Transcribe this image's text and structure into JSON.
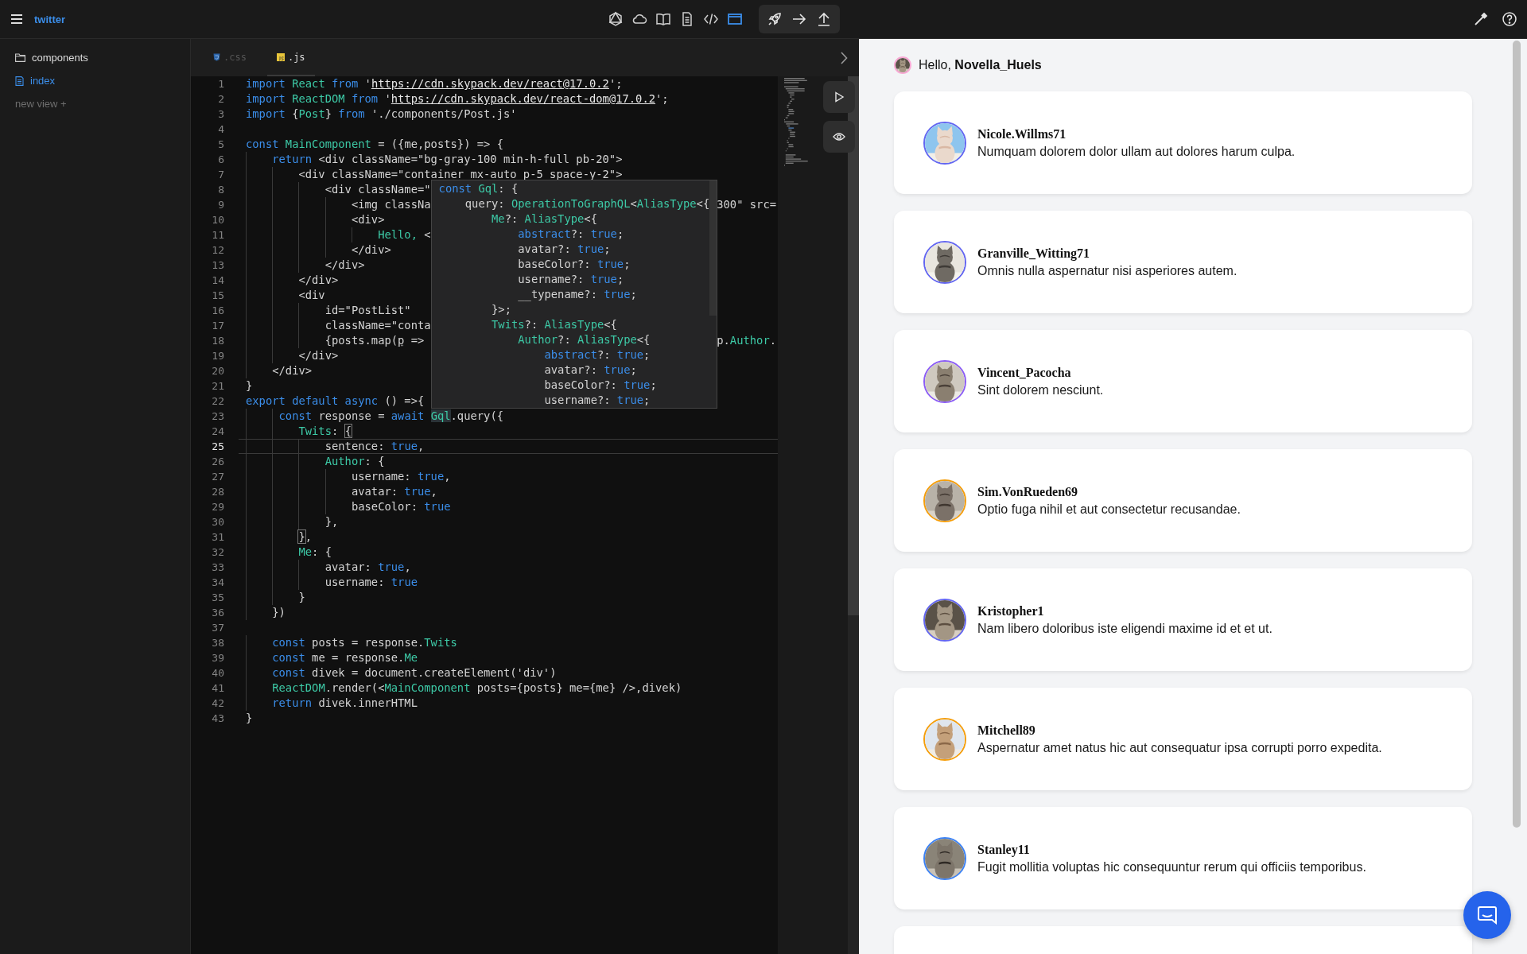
{
  "app": {
    "title": "twitter"
  },
  "toolbar": {
    "tools": [
      {
        "kind": "graph",
        "selected": false
      },
      {
        "kind": "cloud",
        "selected": false
      },
      {
        "kind": "book",
        "selected": false
      },
      {
        "kind": "document",
        "selected": false
      },
      {
        "kind": "code",
        "selected": false
      },
      {
        "kind": "window",
        "selected": true
      }
    ],
    "actions": [
      {
        "kind": "rocket"
      },
      {
        "kind": "arrow"
      },
      {
        "kind": "upload"
      }
    ]
  },
  "sidebar": {
    "items": [
      {
        "label": "components",
        "kind": "folder",
        "selected": false
      },
      {
        "label": "index",
        "kind": "file",
        "selected": true
      }
    ],
    "new_view": "new view +"
  },
  "tabs": [
    {
      "label": ".css",
      "kind": "css",
      "selected": false
    },
    {
      "label": ".js",
      "kind": "js",
      "selected": true
    }
  ],
  "editor": {
    "lines": [
      {
        "number": "1",
        "current": false,
        "segments": [
          {
            "kind": "kw",
            "text": "import"
          },
          {
            "kind": "type",
            "text": " React"
          },
          {
            "kind": "kw",
            "text": " from"
          },
          {
            "kind": "plain",
            "text": " '"
          },
          {
            "kind": "url",
            "text": "https://cdn.skypack.dev/react@17.0.2"
          },
          {
            "kind": "plain",
            "text": "';"
          }
        ]
      },
      {
        "number": "2",
        "current": false,
        "segments": [
          {
            "kind": "kw",
            "text": "import"
          },
          {
            "kind": "type",
            "text": " ReactDOM"
          },
          {
            "kind": "kw",
            "text": " from"
          },
          {
            "kind": "plain",
            "text": " '"
          },
          {
            "kind": "url",
            "text": "https://cdn.skypack.dev/react-dom@17.0.2"
          },
          {
            "kind": "plain",
            "text": "';"
          }
        ]
      },
      {
        "number": "3",
        "current": false,
        "segments": [
          {
            "kind": "kw",
            "text": "import"
          },
          {
            "kind": "plain",
            "text": " {"
          },
          {
            "kind": "type",
            "text": "Post"
          },
          {
            "kind": "plain",
            "text": "} "
          },
          {
            "kind": "kw",
            "text": "from"
          },
          {
            "kind": "plain",
            "text": " './components/Post.js'"
          }
        ]
      },
      {
        "number": "4",
        "current": false
      },
      {
        "number": "5",
        "current": false,
        "segments": [
          {
            "kind": "kw",
            "text": "const"
          },
          {
            "kind": "type",
            "text": " MainComponent"
          },
          {
            "kind": "plain",
            "text": " = ({me,posts}) => {"
          }
        ]
      },
      {
        "number": "6",
        "current": false,
        "segments": [
          {
            "kind": "kw",
            "text": "    return"
          },
          {
            "kind": "plain",
            "text": " <div className=\"bg-gray-100 min-h-full pb-20\">"
          }
        ]
      },
      {
        "number": "7",
        "current": false,
        "segments": [
          {
            "kind": "plain",
            "text": "        <div className=\"container mx-auto p-5 space-y-2\">"
          }
        ]
      },
      {
        "number": "8",
        "current": false,
        "segments": [
          {
            "kind": "plain",
            "text": "            <div className=\""
          }
        ]
      },
      {
        "number": "9",
        "current": false,
        "segments": [
          {
            "kind": "plain",
            "text": "                <img classNa"
          }
        ],
        "after": [
          {
            "kind": "plain",
            "text": "300\" src="
          }
        ]
      },
      {
        "number": "10",
        "current": false,
        "segments": [
          {
            "kind": "plain",
            "text": "                <div>"
          }
        ]
      },
      {
        "number": "11",
        "current": false,
        "segments": [
          {
            "kind": "type",
            "text": "                    Hello,"
          },
          {
            "kind": "plain",
            "text": " <"
          }
        ]
      },
      {
        "number": "12",
        "current": false,
        "segments": [
          {
            "kind": "plain",
            "text": "                </div>"
          }
        ]
      },
      {
        "number": "13",
        "current": false,
        "segments": [
          {
            "kind": "plain",
            "text": "            </div>"
          }
        ]
      },
      {
        "number": "14",
        "current": false,
        "segments": [
          {
            "kind": "plain",
            "text": "        </div>"
          }
        ]
      },
      {
        "number": "15",
        "current": false,
        "segments": [
          {
            "kind": "plain",
            "text": "        <div"
          }
        ]
      },
      {
        "number": "16",
        "current": false,
        "segments": [
          {
            "kind": "plain",
            "text": "            id=\"PostList\""
          }
        ]
      },
      {
        "number": "17",
        "current": false,
        "segments": [
          {
            "kind": "plain",
            "text": "            className=\"conta"
          }
        ]
      },
      {
        "number": "18",
        "current": false,
        "segments": [
          {
            "kind": "plain",
            "text": "            {posts.map("
          },
          {
            "kind": "squiggle",
            "text": "p"
          },
          {
            "kind": "plain",
            "text": " =>"
          }
        ],
        "after": [
          {
            "kind": "plain",
            "text": "p."
          },
          {
            "kind": "type",
            "text": "Author"
          },
          {
            "kind": "plain",
            "text": "."
          }
        ]
      },
      {
        "number": "19",
        "current": false,
        "segments": [
          {
            "kind": "plain",
            "text": "        </div>"
          }
        ]
      },
      {
        "number": "20",
        "current": false,
        "segments": [
          {
            "kind": "plain",
            "text": "    </div>"
          }
        ]
      },
      {
        "number": "21",
        "current": false,
        "segments": [
          {
            "kind": "plain",
            "text": "}"
          }
        ]
      },
      {
        "number": "22",
        "current": false,
        "segments": [
          {
            "kind": "kw",
            "text": "export default async"
          },
          {
            "kind": "plain",
            "text": " () =>{"
          }
        ]
      },
      {
        "number": "23",
        "current": false,
        "segments": [
          {
            "kind": "kw",
            "text": "     const"
          },
          {
            "kind": "plain",
            "text": " response = "
          },
          {
            "kind": "kw",
            "text": "await"
          },
          {
            "kind": "highlight",
            "text": " Gql"
          },
          {
            "kind": "plain",
            "text": ".query({"
          }
        ]
      },
      {
        "number": "24",
        "current": false,
        "segments": [
          {
            "kind": "type",
            "text": "        Twits"
          },
          {
            "kind": "plain",
            "text": ": "
          },
          {
            "kind": "bracket",
            "text": "{"
          }
        ]
      },
      {
        "number": "25",
        "current": true,
        "segments": [
          {
            "kind": "plain",
            "text": "            sentence: "
          },
          {
            "kind": "kw",
            "text": "true"
          },
          {
            "kind": "plain",
            "text": ","
          }
        ]
      },
      {
        "number": "26",
        "current": false,
        "segments": [
          {
            "kind": "type",
            "text": "            Author"
          },
          {
            "kind": "plain",
            "text": ": {"
          }
        ]
      },
      {
        "number": "27",
        "current": false,
        "segments": [
          {
            "kind": "plain",
            "text": "                username: "
          },
          {
            "kind": "kw",
            "text": "true"
          },
          {
            "kind": "plain",
            "text": ","
          }
        ]
      },
      {
        "number": "28",
        "current": false,
        "segments": [
          {
            "kind": "plain",
            "text": "                avatar: "
          },
          {
            "kind": "kw",
            "text": "true"
          },
          {
            "kind": "plain",
            "text": ","
          }
        ]
      },
      {
        "number": "29",
        "current": false,
        "segments": [
          {
            "kind": "plain",
            "text": "                baseColor: "
          },
          {
            "kind": "kw",
            "text": "true"
          }
        ]
      },
      {
        "number": "30",
        "current": false,
        "segments": [
          {
            "kind": "plain",
            "text": "            },"
          }
        ]
      },
      {
        "number": "31",
        "current": false,
        "segments": [
          {
            "kind": "bracket",
            "text": "        }"
          },
          {
            "kind": "plain",
            "text": ","
          }
        ]
      },
      {
        "number": "32",
        "current": false,
        "segments": [
          {
            "kind": "type",
            "text": "        Me"
          },
          {
            "kind": "plain",
            "text": ": {"
          }
        ]
      },
      {
        "number": "33",
        "current": false,
        "segments": [
          {
            "kind": "plain",
            "text": "            avatar: "
          },
          {
            "kind": "kw",
            "text": "true"
          },
          {
            "kind": "plain",
            "text": ","
          }
        ]
      },
      {
        "number": "34",
        "current": false,
        "segments": [
          {
            "kind": "plain",
            "text": "            username: "
          },
          {
            "kind": "kw",
            "text": "true"
          }
        ]
      },
      {
        "number": "35",
        "current": false,
        "segments": [
          {
            "kind": "plain",
            "text": "        }"
          }
        ]
      },
      {
        "number": "36",
        "current": false,
        "segments": [
          {
            "kind": "plain",
            "text": "    })"
          }
        ]
      },
      {
        "number": "37",
        "current": false
      },
      {
        "number": "38",
        "current": false,
        "segments": [
          {
            "kind": "kw",
            "text": "    const"
          },
          {
            "kind": "plain",
            "text": " posts = response."
          },
          {
            "kind": "type",
            "text": "Twits"
          }
        ]
      },
      {
        "number": "39",
        "current": false,
        "segments": [
          {
            "kind": "kw",
            "text": "    const"
          },
          {
            "kind": "plain",
            "text": " me = response."
          },
          {
            "kind": "type",
            "text": "Me"
          }
        ]
      },
      {
        "number": "40",
        "current": false,
        "segments": [
          {
            "kind": "kw",
            "text": "    const"
          },
          {
            "kind": "plain",
            "text": " divek = document.createElement('div')"
          }
        ]
      },
      {
        "number": "41",
        "current": false,
        "segments": [
          {
            "kind": "type",
            "text": "    ReactDOM"
          },
          {
            "kind": "plain",
            "text": ".render(<"
          },
          {
            "kind": "type",
            "text": "MainComponent"
          },
          {
            "kind": "plain",
            "text": " posts={posts} me={me} />,divek)"
          }
        ]
      },
      {
        "number": "42",
        "current": false,
        "segments": [
          {
            "kind": "kw",
            "text": "    return"
          },
          {
            "kind": "plain",
            "text": " divek.innerHTML"
          }
        ]
      },
      {
        "number": "43",
        "current": false,
        "segments": [
          {
            "kind": "plain",
            "text": "}"
          }
        ]
      }
    ],
    "tooltip": [
      [
        {
          "kind": "kw",
          "text": "const"
        },
        {
          "kind": "type",
          "text": " Gql"
        },
        {
          "kind": "plain",
          "text": ": {"
        }
      ],
      [
        {
          "kind": "plain",
          "text": "    query: "
        },
        {
          "kind": "type",
          "text": "OperationToGraphQL"
        },
        {
          "kind": "plain",
          "text": "<"
        },
        {
          "kind": "type",
          "text": "AliasType"
        },
        {
          "kind": "plain",
          "text": "<{"
        }
      ],
      [
        {
          "kind": "type",
          "text": "        Me"
        },
        {
          "kind": "plain",
          "text": "?: "
        },
        {
          "kind": "type",
          "text": "AliasType"
        },
        {
          "kind": "plain",
          "text": "<{"
        }
      ],
      [
        {
          "kind": "kw",
          "text": "            abstract"
        },
        {
          "kind": "plain",
          "text": "?: "
        },
        {
          "kind": "kw",
          "text": "true"
        },
        {
          "kind": "plain",
          "text": ";"
        }
      ],
      [
        {
          "kind": "plain",
          "text": "            avatar?: "
        },
        {
          "kind": "kw",
          "text": "true"
        },
        {
          "kind": "plain",
          "text": ";"
        }
      ],
      [
        {
          "kind": "plain",
          "text": "            baseColor?: "
        },
        {
          "kind": "kw",
          "text": "true"
        },
        {
          "kind": "plain",
          "text": ";"
        }
      ],
      [
        {
          "kind": "plain",
          "text": "            username?: "
        },
        {
          "kind": "kw",
          "text": "true"
        },
        {
          "kind": "plain",
          "text": ";"
        }
      ],
      [
        {
          "kind": "plain",
          "text": "            __typename?: "
        },
        {
          "kind": "kw",
          "text": "true"
        },
        {
          "kind": "plain",
          "text": ";"
        }
      ],
      [
        {
          "kind": "plain",
          "text": "        }>;"
        }
      ],
      [
        {
          "kind": "type",
          "text": "        Twits"
        },
        {
          "kind": "plain",
          "text": "?: "
        },
        {
          "kind": "type",
          "text": "AliasType"
        },
        {
          "kind": "plain",
          "text": "<{"
        }
      ],
      [
        {
          "kind": "type",
          "text": "            Author"
        },
        {
          "kind": "plain",
          "text": "?: "
        },
        {
          "kind": "type",
          "text": "AliasType"
        },
        {
          "kind": "plain",
          "text": "<{"
        }
      ],
      [
        {
          "kind": "kw",
          "text": "                abstract"
        },
        {
          "kind": "plain",
          "text": "?: "
        },
        {
          "kind": "kw",
          "text": "true"
        },
        {
          "kind": "plain",
          "text": ";"
        }
      ],
      [
        {
          "kind": "plain",
          "text": "                avatar?: "
        },
        {
          "kind": "kw",
          "text": "true"
        },
        {
          "kind": "plain",
          "text": ";"
        }
      ],
      [
        {
          "kind": "plain",
          "text": "                baseColor?: "
        },
        {
          "kind": "kw",
          "text": "true"
        },
        {
          "kind": "plain",
          "text": ";"
        }
      ],
      [
        {
          "kind": "plain",
          "text": "                username?: "
        },
        {
          "kind": "kw",
          "text": "true"
        },
        {
          "kind": "plain",
          "text": ";"
        }
      ]
    ]
  },
  "preview": {
    "greeting": "Hello, **Novella_Huels**",
    "posts": [
      {
        "username": "Nicole.Willms71",
        "sentence": "Numquam dolorem dolor ullam aut dolores harum culpa.",
        "color": "#6366f1"
      },
      {
        "username": "Granville_Witting71",
        "sentence": "Omnis nulla aspernatur nisi asperiores autem.",
        "color": "#6366f1"
      },
      {
        "username": "Vincent_Pacocha",
        "sentence": "Sint dolorem nesciunt.",
        "color": "#8b5cf6"
      },
      {
        "username": "Sim.VonRueden69",
        "sentence": "Optio fuga nihil et aut consectetur recusandae.",
        "color": "#f59e0b"
      },
      {
        "username": "Kristopher1",
        "sentence": "Nam libero doloribus iste eligendi maxime id et et ut.",
        "color": "#6366f1"
      },
      {
        "username": "Mitchell89",
        "sentence": "Aspernatur amet natus hic aut consequatur ipsa corrupti porro expedita.",
        "color": "#f59e0b"
      },
      {
        "username": "Stanley11",
        "sentence": "Fugit mollitia voluptas hic consequuntur rerum qui officiis temporibus.",
        "color": "#3b82f6"
      }
    ]
  }
}
